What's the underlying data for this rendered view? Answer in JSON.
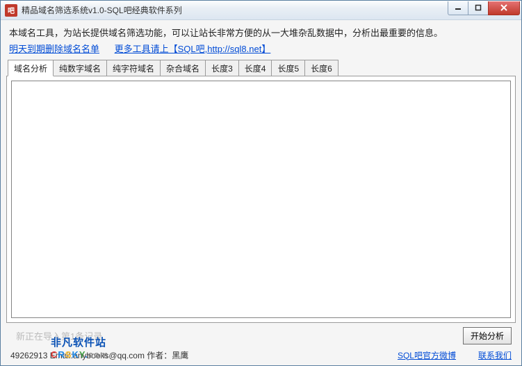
{
  "window": {
    "title": "精品域名筛选系统v1.0-SQL吧经典软件系列",
    "app_icon_label": "吧"
  },
  "intro": "本域名工具，为站长提供域名筛选功能，可以让站长非常方便的从一大堆杂乱数据中，分析出最重要的信息。",
  "links": {
    "deleted_domains": "明天到期删除域名名单",
    "more_tools": "更多工具请上【SQL吧,http://sql8.net】"
  },
  "tabs": [
    {
      "id": "analysis",
      "label": "域名分析",
      "active": true
    },
    {
      "id": "numeric",
      "label": "纯数字域名",
      "active": false
    },
    {
      "id": "alpha",
      "label": "纯字符域名",
      "active": false
    },
    {
      "id": "mixed",
      "label": "杂合域名",
      "active": false
    },
    {
      "id": "len3",
      "label": "长度3",
      "active": false
    },
    {
      "id": "len4",
      "label": "长度4",
      "active": false
    },
    {
      "id": "len5",
      "label": "长度5",
      "active": false
    },
    {
      "id": "len6",
      "label": "长度6",
      "active": false
    }
  ],
  "textarea_value": "",
  "status_ghost": "新正在导入第1条记录",
  "buttons": {
    "analyze": "开始分析"
  },
  "footer": {
    "contact": "49262913   Email:anybooks@qq.com   作者：黑鹰",
    "weibo": "SQL吧官方微博",
    "contact_us": "联系我们"
  },
  "watermark": {
    "cn": "非凡软件站",
    "en": "CRSKY.com"
  }
}
